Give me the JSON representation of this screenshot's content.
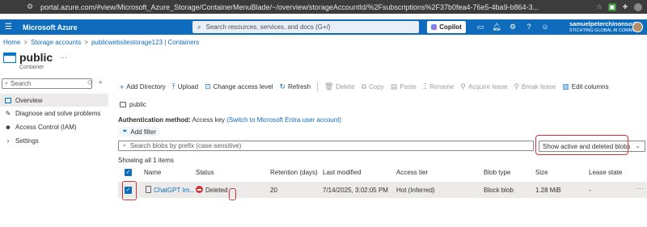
{
  "browser": {
    "url": "portal.azure.com/#view/Microsoft_Azure_Storage/ContainerMenuBlade/~/overview/storageAccountId/%2Fsubscriptions%2F37b0fea4-76e5-4ba9-b864-3..."
  },
  "header": {
    "brand": "Microsoft Azure",
    "search_placeholder": "Search resources, services, and docs (G+/)",
    "copilot_label": "Copilot",
    "user_name": "samuelpeterchinonso@...",
    "user_org": "STICHTING GLOBAL AI COMMU..."
  },
  "breadcrumb": {
    "items": [
      "Home",
      "Storage accounts",
      "publicwebsitestorage123 | Containers"
    ],
    "separator": ">"
  },
  "title": {
    "name": "public",
    "more": "···",
    "subtitle": "Container"
  },
  "nav": {
    "search_placeholder": "Search",
    "collapse": "«",
    "reset": "◇",
    "items": [
      {
        "label": "Overview",
        "icon": "container-icon",
        "active": true
      },
      {
        "label": "Diagnose and solve problems",
        "icon": "wrench-icon"
      },
      {
        "label": "Access Control (IAM)",
        "icon": "people-icon"
      },
      {
        "label": "Settings",
        "icon": "chevron-right-icon"
      }
    ]
  },
  "toolbar": {
    "add_directory": "Add Directory",
    "upload": "Upload",
    "change_access": "Change access level",
    "refresh": "Refresh",
    "delete": "Delete",
    "copy": "Copy",
    "paste": "Paste",
    "rename": "Rename",
    "acquire_lease": "Acquire lease",
    "break_lease": "Break lease",
    "edit_columns": "Edit columns"
  },
  "path": "public",
  "auth": {
    "label": "Authentication method:",
    "value": "Access key",
    "switch_link": "(Switch to Microsoft Entra user account)"
  },
  "filter": {
    "add_filter": "Add filter",
    "search_placeholder": "Search blobs by prefix (case-sensitive)",
    "dropdown_value": "Show active and deleted blobs"
  },
  "showing": "Showing all 1 items",
  "table": {
    "columns": [
      "Name",
      "Status",
      "Retention (days)",
      "Last modified",
      "Access tier",
      "Blob type",
      "Size",
      "Lease state"
    ],
    "rows": [
      {
        "name": "ChatGPT Im...",
        "status": "Deleted",
        "retention": "20",
        "last_modified": "7/14/2025, 3:02:05 PM",
        "access_tier": "Hot (Inferred)",
        "blob_type": "Block blob",
        "size": "1.28 MiB",
        "lease_state": "-",
        "more": "···"
      }
    ]
  },
  "colors": {
    "azure_blue": "#0f6cbd",
    "highlight_red": "#d13438",
    "selected_row": "#edebe9"
  }
}
